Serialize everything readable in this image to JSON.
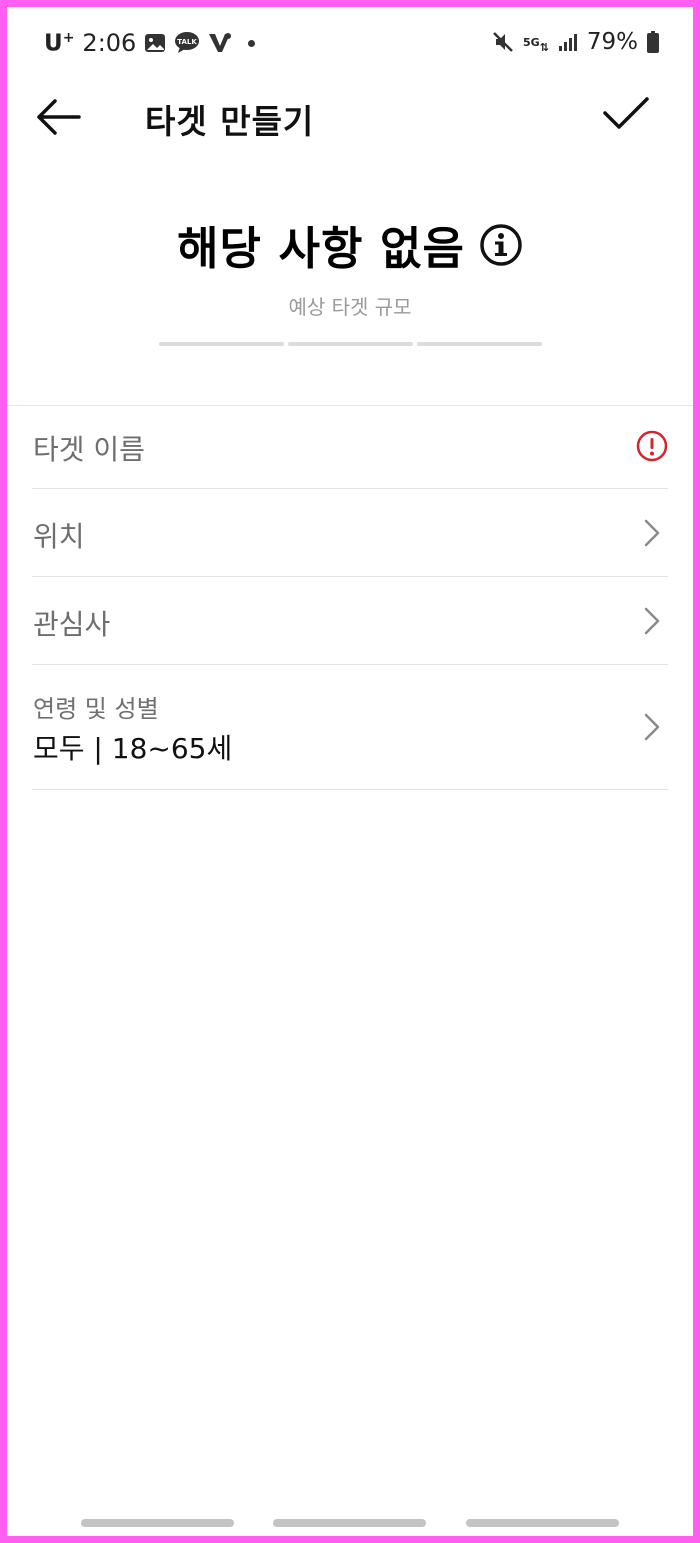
{
  "status_bar": {
    "carrier": "U",
    "carrier_sup": "+",
    "time": "2:06",
    "talk_label": "TALK",
    "network": "5G",
    "battery": "79%",
    "icons": [
      "gallery-icon",
      "kakaotalk-icon",
      "v-app-icon",
      "mute-icon",
      "signal-icon",
      "battery-icon"
    ]
  },
  "header": {
    "title": "타겟 만들기"
  },
  "estimate": {
    "value": "해당 사항 없음",
    "label": "예상 타겟 규모"
  },
  "rows": {
    "target_name": {
      "label": "타겟 이름",
      "status": "error"
    },
    "location": {
      "label": "위치"
    },
    "interests": {
      "label": "관심사"
    },
    "age_gender": {
      "label": "연령 및 성별",
      "value": "모두 | 18~65세"
    }
  },
  "colors": {
    "border": "#ff5ef0",
    "error": "#d0262b",
    "text": "#111111",
    "muted": "#6e6e6e"
  }
}
